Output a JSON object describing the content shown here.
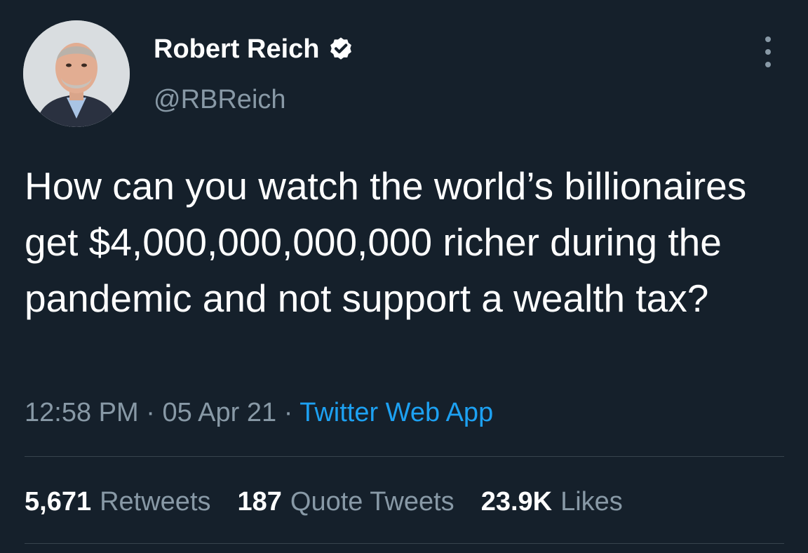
{
  "user": {
    "name": "Robert Reich",
    "handle": "@RBReich",
    "verified_icon": "verified-badge-icon"
  },
  "tweet": {
    "text": "How can you watch the world’s billionaires get $4,000,000,000,000 richer during the pandemic and not support a wealth tax?",
    "time": "12:58 PM",
    "sep1": "·",
    "date": "05 Apr 21",
    "sep2": "·",
    "source": "Twitter Web App"
  },
  "stats": {
    "retweets": {
      "count": "5,671",
      "label": "Retweets"
    },
    "quotes": {
      "count": "187",
      "label": "Quote Tweets"
    },
    "likes": {
      "count": "23.9K",
      "label": "Likes"
    }
  },
  "colors": {
    "background": "#15202b",
    "primary_text": "#ffffff",
    "secondary_text": "#8899a6",
    "link": "#1da1f2",
    "divider": "#38444d"
  }
}
